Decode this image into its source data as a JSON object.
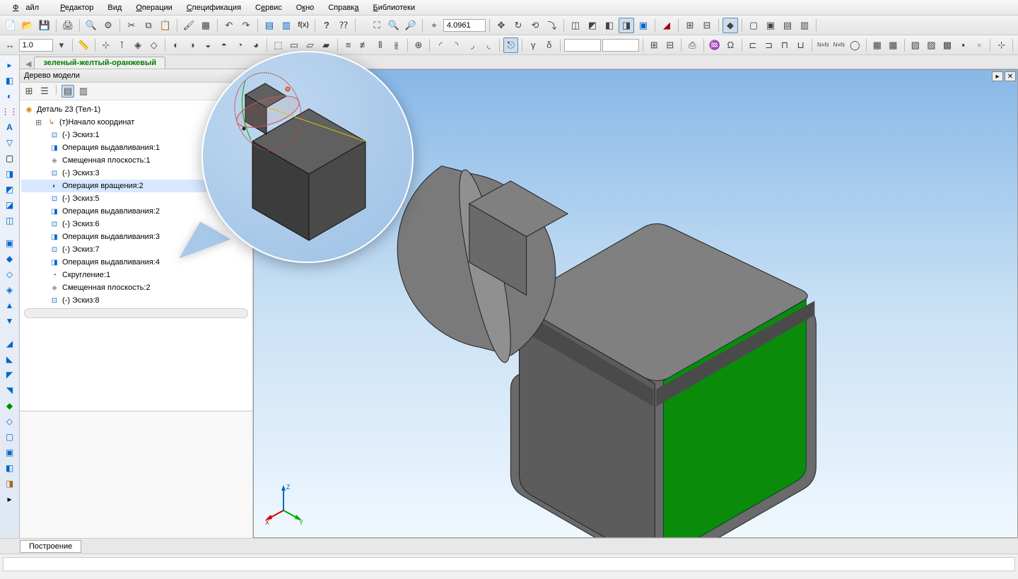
{
  "menu": {
    "file": "Файл",
    "editor": "Редактор",
    "view": "Вид",
    "operations": "Операции",
    "spec": "Спецификация",
    "service": "Сервис",
    "window": "Окно",
    "help": "Справка",
    "libs": "Библиотеки"
  },
  "toolbar1": {
    "zoom_value": "4.0961"
  },
  "toolbar2": {
    "step_value": "1.0"
  },
  "doc_tab": "зеленый-желтый-оранжевый",
  "panel_title": "Дерево модели",
  "tree": {
    "root": "Деталь 23 (Тел-1)",
    "items": [
      "(т)Начало координат",
      "(-) Эскиз:1",
      "Операция выдавливания:1",
      "Смещенная плоскость:1",
      "(-) Эскиз:3",
      "Операция вращения:2",
      "(-) Эскиз:5",
      "Операция выдавливания:2",
      "(-) Эскиз:6",
      "Операция выдавливания:3",
      "(-) Эскиз:7",
      "Операция выдавливания:4",
      "Скругление:1",
      "Смещенная плоскость:2",
      "(-) Эскиз:8"
    ]
  },
  "axes": {
    "x": "X",
    "y": "Y",
    "z": "Z"
  },
  "bottom_tab": "Построение",
  "icons": {
    "new": "□",
    "open": "📂",
    "save": "💾",
    "print": "🖨",
    "preview": "🔍",
    "cut": "✂",
    "copy": "⧉",
    "paste": "📋",
    "undo": "↶",
    "redo": "↷",
    "fx": "f(x)",
    "help": "?",
    "zoom_fit": "⛶",
    "zoom_in": "🔍+",
    "zoom_out": "🔍-",
    "pan": "✥",
    "rotate": "↻",
    "cube": "◧",
    "wireframe": "▦"
  },
  "colors": {
    "sel_face": "#0a8c0a",
    "body": "#6a6a6a"
  }
}
